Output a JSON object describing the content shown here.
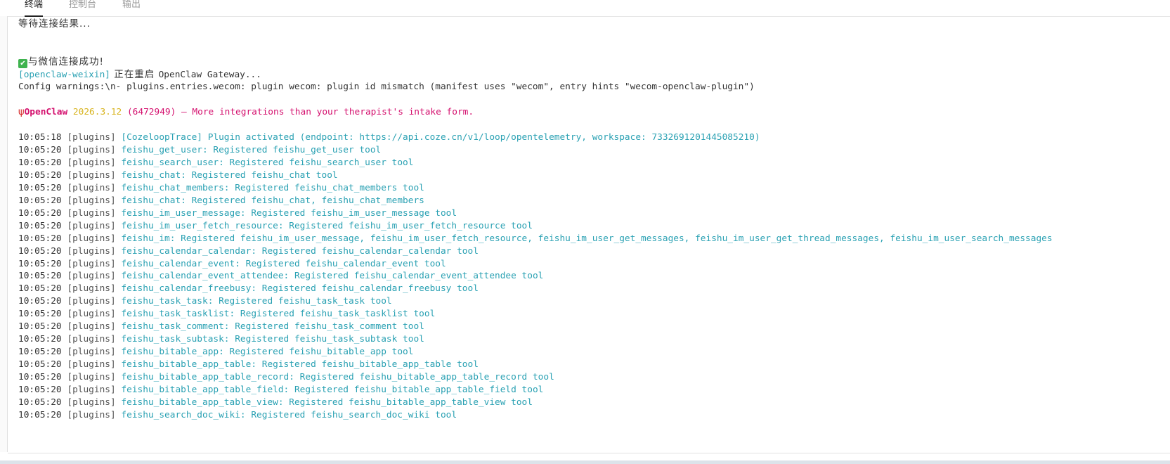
{
  "tabs": [
    {
      "label": "终端",
      "active": true
    },
    {
      "label": "控制台",
      "active": false
    },
    {
      "label": "输出",
      "active": false
    }
  ],
  "terminal": {
    "waiting_line": "等待连接结果...",
    "success_line": "与微信连接成功!",
    "restart": {
      "prefix": "[openclaw-weixin]",
      "message_cn": " 正在重启 ",
      "message_en": "OpenClaw Gateway..."
    },
    "config_warning": "Config warnings:\\n- plugins.entries.wecom: plugin wecom: plugin id mismatch (manifest uses \"wecom\", entry hints \"wecom-openclaw-plugin\")",
    "banner": {
      "name": "OpenClaw",
      "version": " 2026.3.12",
      "build": " (6472949)",
      "tagline": " — More integrations than your therapist's intake form."
    },
    "logs": [
      {
        "time": "10:05:18",
        "tag": "[plugins]",
        "message": "[CozeloopTrace] Plugin activated (endpoint: https://api.coze.cn/v1/loop/opentelemetry, workspace: 7332691201445085210)"
      },
      {
        "time": "10:05:20",
        "tag": "[plugins]",
        "message": "feishu_get_user: Registered feishu_get_user tool"
      },
      {
        "time": "10:05:20",
        "tag": "[plugins]",
        "message": "feishu_search_user: Registered feishu_search_user tool"
      },
      {
        "time": "10:05:20",
        "tag": "[plugins]",
        "message": "feishu_chat: Registered feishu_chat tool"
      },
      {
        "time": "10:05:20",
        "tag": "[plugins]",
        "message": "feishu_chat_members: Registered feishu_chat_members tool"
      },
      {
        "time": "10:05:20",
        "tag": "[plugins]",
        "message": "feishu_chat: Registered feishu_chat, feishu_chat_members"
      },
      {
        "time": "10:05:20",
        "tag": "[plugins]",
        "message": "feishu_im_user_message: Registered feishu_im_user_message tool"
      },
      {
        "time": "10:05:20",
        "tag": "[plugins]",
        "message": "feishu_im_user_fetch_resource: Registered feishu_im_user_fetch_resource tool"
      },
      {
        "time": "10:05:20",
        "tag": "[plugins]",
        "message": "feishu_im: Registered feishu_im_user_message, feishu_im_user_fetch_resource, feishu_im_user_get_messages, feishu_im_user_get_thread_messages, feishu_im_user_search_messages"
      },
      {
        "time": "10:05:20",
        "tag": "[plugins]",
        "message": "feishu_calendar_calendar: Registered feishu_calendar_calendar tool"
      },
      {
        "time": "10:05:20",
        "tag": "[plugins]",
        "message": "feishu_calendar_event: Registered feishu_calendar_event tool"
      },
      {
        "time": "10:05:20",
        "tag": "[plugins]",
        "message": "feishu_calendar_event_attendee: Registered feishu_calendar_event_attendee tool"
      },
      {
        "time": "10:05:20",
        "tag": "[plugins]",
        "message": "feishu_calendar_freebusy: Registered feishu_calendar_freebusy tool"
      },
      {
        "time": "10:05:20",
        "tag": "[plugins]",
        "message": "feishu_task_task: Registered feishu_task_task tool"
      },
      {
        "time": "10:05:20",
        "tag": "[plugins]",
        "message": "feishu_task_tasklist: Registered feishu_task_tasklist tool"
      },
      {
        "time": "10:05:20",
        "tag": "[plugins]",
        "message": "feishu_task_comment: Registered feishu_task_comment tool"
      },
      {
        "time": "10:05:20",
        "tag": "[plugins]",
        "message": "feishu_task_subtask: Registered feishu_task_subtask tool"
      },
      {
        "time": "10:05:20",
        "tag": "[plugins]",
        "message": "feishu_bitable_app: Registered feishu_bitable_app tool"
      },
      {
        "time": "10:05:20",
        "tag": "[plugins]",
        "message": "feishu_bitable_app_table: Registered feishu_bitable_app_table tool"
      },
      {
        "time": "10:05:20",
        "tag": "[plugins]",
        "message": "feishu_bitable_app_table_record: Registered feishu_bitable_app_table_record tool"
      },
      {
        "time": "10:05:20",
        "tag": "[plugins]",
        "message": "feishu_bitable_app_table_field: Registered feishu_bitable_app_table_field tool"
      },
      {
        "time": "10:05:20",
        "tag": "[plugins]",
        "message": "feishu_bitable_app_table_view: Registered feishu_bitable_app_table_view tool"
      },
      {
        "time": "10:05:20",
        "tag": "[plugins]",
        "message": "feishu_search_doc_wiki: Registered feishu_search_doc_wiki tool"
      }
    ]
  },
  "colors": {
    "log_message": "#2aa1b3",
    "log_tag": "#555555",
    "banner_name": "#d4106e",
    "banner_version": "#d7b31c",
    "success_check": "#3fb34f"
  },
  "icons": {
    "success": "check-mark-icon",
    "banner": "lobster-icon"
  }
}
